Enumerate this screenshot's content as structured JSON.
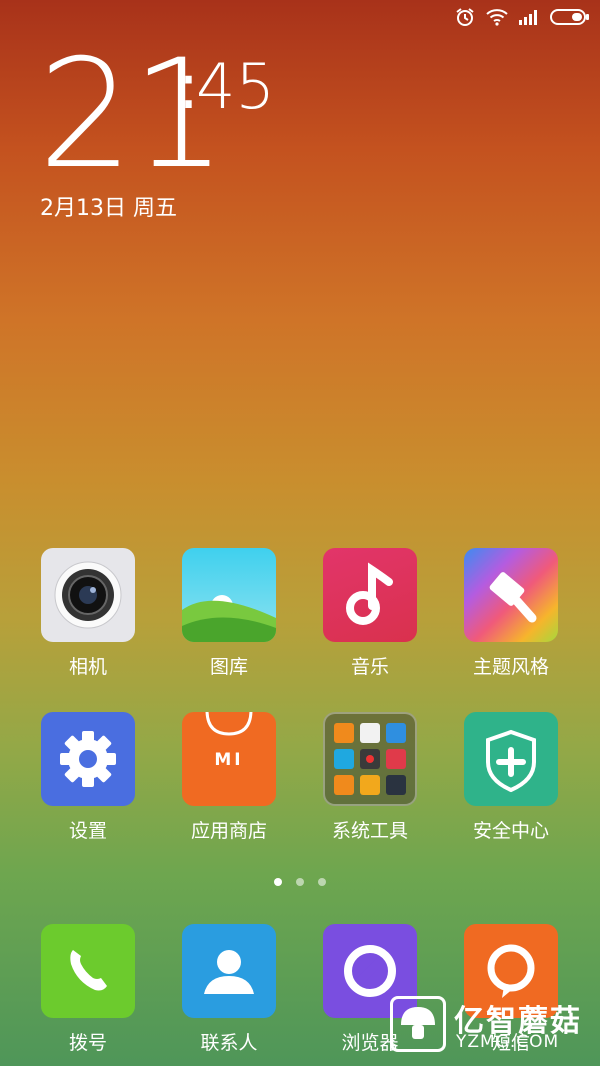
{
  "status_bar": {
    "icons": [
      "alarm-icon",
      "wifi-icon",
      "signal-icon",
      "battery-icon"
    ]
  },
  "clock": {
    "hour": "21",
    "minute": "45",
    "colon": ":"
  },
  "date": "2月13日 周五",
  "apps_row1": [
    {
      "label": "相机",
      "icon": "camera-icon"
    },
    {
      "label": "图库",
      "icon": "gallery-icon"
    },
    {
      "label": "音乐",
      "icon": "music-icon"
    },
    {
      "label": "主题风格",
      "icon": "theme-icon"
    }
  ],
  "apps_row2": [
    {
      "label": "设置",
      "icon": "settings-icon"
    },
    {
      "label": "应用商店",
      "icon": "app-store-icon",
      "badge": "MI"
    },
    {
      "label": "系统工具",
      "icon": "system-tools-folder"
    },
    {
      "label": "安全中心",
      "icon": "security-icon"
    }
  ],
  "dock": [
    {
      "label": "拨号",
      "icon": "phone-icon"
    },
    {
      "label": "联系人",
      "icon": "contacts-icon"
    },
    {
      "label": "浏览器",
      "icon": "browser-icon"
    },
    {
      "label": "短信",
      "icon": "message-icon"
    }
  ],
  "page_indicator": {
    "count": 3,
    "active": 1
  },
  "watermark": {
    "name": "亿智蘑菇",
    "url": "YZMG.COM"
  },
  "colors": {
    "camera": "#e6e6ea",
    "gallery_sky": "#3fc6e8",
    "gallery_grass": "#5bb83a",
    "music": "#d8315a",
    "settings": "#4a6ee0",
    "store": "#f06a22",
    "tools": "#5a5a3c",
    "security": "#2fb38a",
    "phone": "#6ccb2d",
    "contacts": "#2a9de0",
    "browser": "#7a4ee0",
    "message": "#f06a22"
  }
}
